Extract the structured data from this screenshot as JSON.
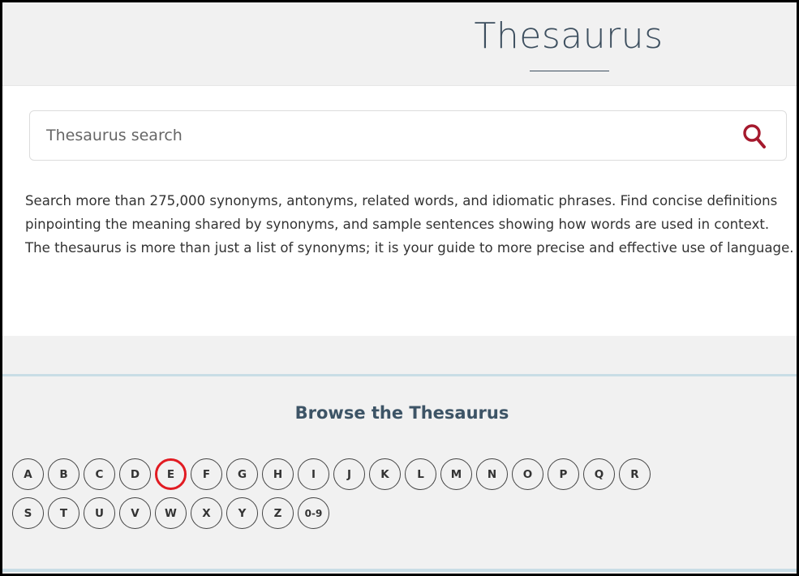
{
  "header": {
    "title": "Thesaurus"
  },
  "search": {
    "placeholder": "Thesaurus search",
    "value": ""
  },
  "description": "Search more than 275,000 synonyms, antonyms, related words, and idiomatic phrases. Find concise definitions pinpointing the meaning shared by synonyms, and sample sentences showing how words are used in context. The thesaurus is more than just a list of synonyms; it is your guide to more precise and effective use of language.",
  "browse": {
    "heading": "Browse the Thesaurus",
    "letters_row1": [
      "A",
      "B",
      "C",
      "D",
      "E",
      "F",
      "G",
      "H",
      "I",
      "J",
      "K",
      "L",
      "M",
      "N",
      "O",
      "P",
      "Q",
      "R"
    ],
    "letters_row2": [
      "S",
      "T",
      "U",
      "V",
      "W",
      "X",
      "Y",
      "Z",
      "0-9"
    ],
    "highlighted_letter": "E"
  },
  "colors": {
    "accent": "#a5192d",
    "highlight_ring": "#e11b22",
    "heading": "#3d5466",
    "band_rule": "#c9dde6"
  },
  "icons": {
    "search": "search-icon"
  }
}
